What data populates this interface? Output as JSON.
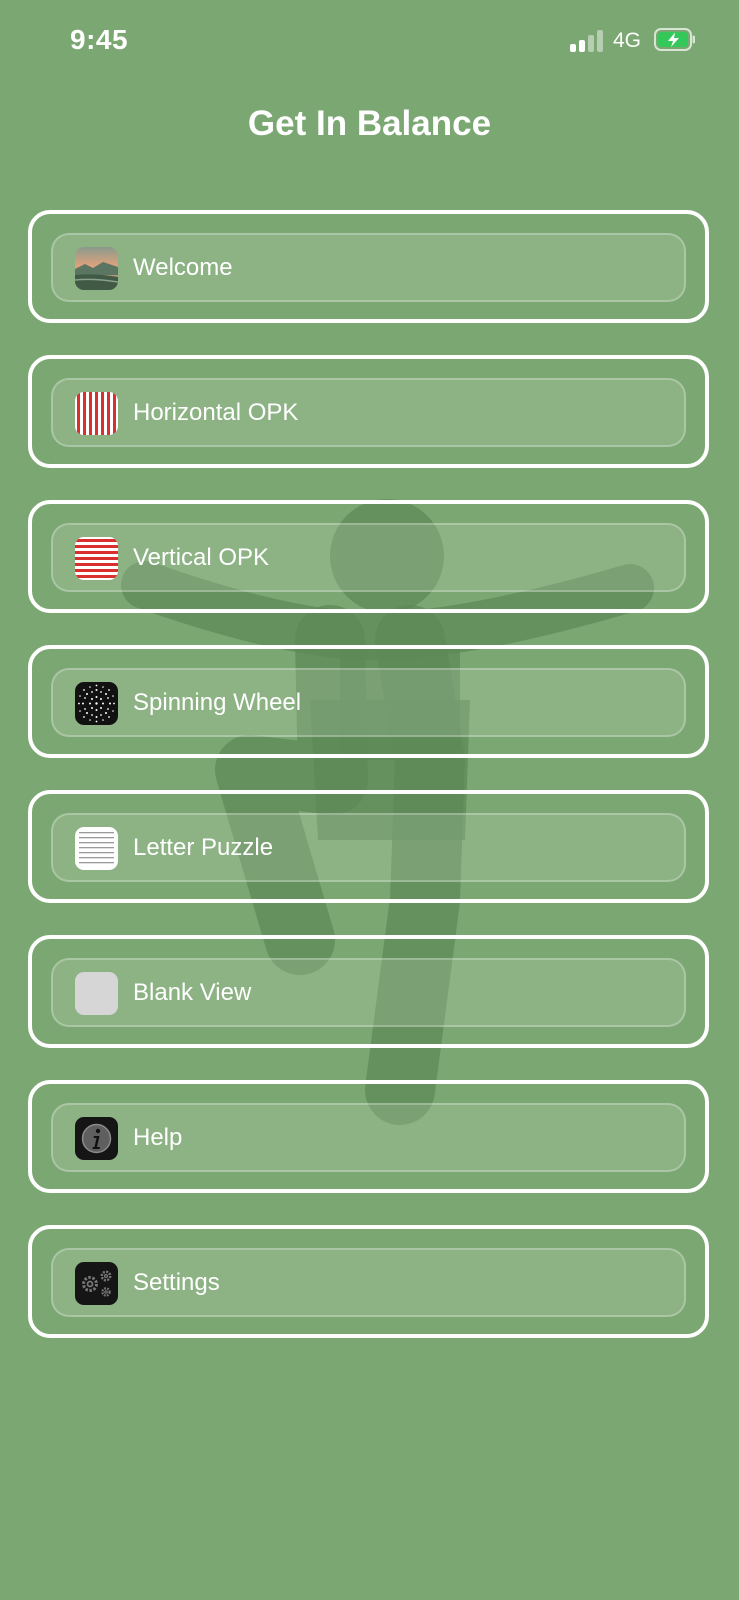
{
  "status_bar": {
    "time": "9:45",
    "network": "4G"
  },
  "header": {
    "title": "Get In Balance"
  },
  "menu": {
    "items": [
      {
        "label": "Welcome",
        "icon": "landscape-icon"
      },
      {
        "label": "Horizontal OPK",
        "icon": "vertical-stripes-icon"
      },
      {
        "label": "Vertical OPK",
        "icon": "horizontal-stripes-icon"
      },
      {
        "label": "Spinning Wheel",
        "icon": "dots-wheel-icon"
      },
      {
        "label": "Letter Puzzle",
        "icon": "letter-grid-icon"
      },
      {
        "label": "Blank View",
        "icon": "blank-icon"
      },
      {
        "label": "Help",
        "icon": "info-icon"
      },
      {
        "label": "Settings",
        "icon": "gears-icon"
      }
    ]
  },
  "colors": {
    "background": "#7ba772",
    "figure": "#5e8a58",
    "border": "#ffffff",
    "stripe_red": "#d9302f",
    "battery_green": "#34c759"
  }
}
